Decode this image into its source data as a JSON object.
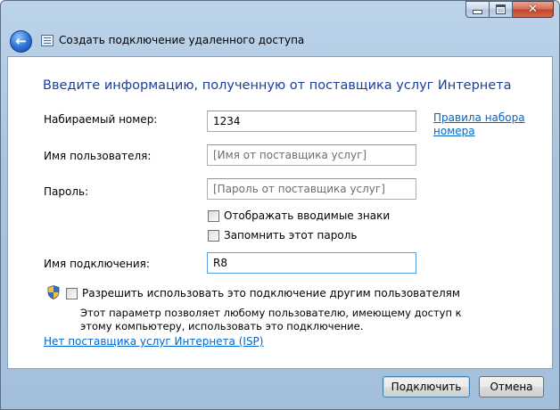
{
  "window": {
    "title": "Создать подключение удаленного доступа"
  },
  "heading": "Введите информацию, полученную от поставщика услуг Интернета",
  "form": {
    "phone": {
      "label": "Набираемый номер:",
      "value": "1234"
    },
    "dialing_rules_link": {
      "line1": "Правила набора",
      "line2": "номера"
    },
    "username": {
      "label": "Имя пользователя:",
      "placeholder": "[Имя от поставщика услуг]"
    },
    "password": {
      "label": "Пароль:",
      "placeholder": "[Пароль от поставщика услуг]"
    },
    "show_chars": {
      "label": "Отображать вводимые знаки"
    },
    "remember_password": {
      "label": "Запомнить этот пароль"
    },
    "connection_name": {
      "label": "Имя подключения:",
      "value": "R8"
    },
    "allow_others": {
      "label": "Разрешить использовать это подключение другим пользователям"
    },
    "allow_others_desc": "Этот параметр позволяет любому пользователю, имеющему доступ к этому компьютеру, использовать это подключение."
  },
  "no_isp_link": "Нет поставщика услуг Интернета (ISP)",
  "buttons": {
    "connect": "Подключить",
    "cancel": "Отмена"
  },
  "icons": {
    "back": "back-arrow-icon",
    "app": "dialup-connection-icon",
    "shield": "uac-shield-icon"
  }
}
